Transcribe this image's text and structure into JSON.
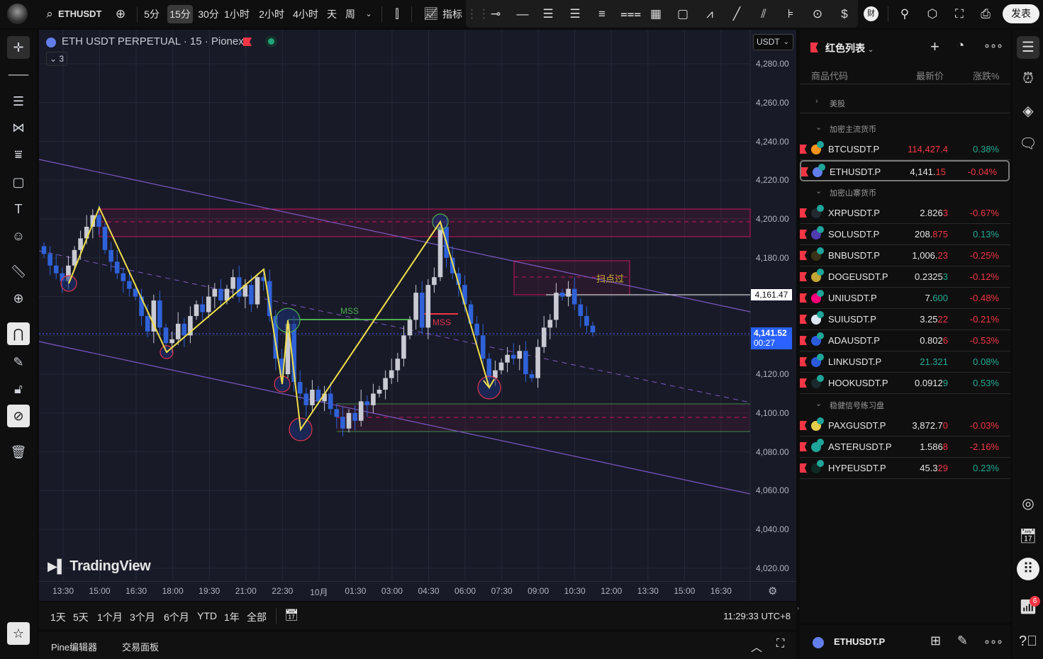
{
  "topbar": {
    "symbol": "ETHUSDT",
    "intervals": [
      "5分",
      "15分",
      "30分",
      "1小时",
      "2小时",
      "4小时",
      "天",
      "周"
    ],
    "selected_interval": "15分",
    "indicators_label": "指标",
    "publish_label": "发表",
    "finance_badge": "财"
  },
  "chart": {
    "title": "ETH USDT PERPETUAL · 15 · Pionex",
    "collapse_count": "3",
    "currency": "USDT",
    "price_ticks": [
      "4,280.00",
      "4,260.00",
      "4,240.00",
      "4,220.00",
      "4,200.00",
      "4,180.00",
      "4,160.00",
      "4,140.00",
      "4,120.00",
      "4,100.00",
      "4,080.00",
      "4,060.00",
      "4,040.00",
      "4,020.00"
    ],
    "time_ticks": [
      "13:30",
      "15:00",
      "16:30",
      "18:00",
      "19:30",
      "21:00",
      "22:30",
      "10月",
      "01:30",
      "03:00",
      "04:30",
      "06:00",
      "07:30",
      "09:00",
      "10:30",
      "12:00",
      "13:30",
      "15:00",
      "16:30"
    ],
    "line_label_price": "4,161.47",
    "last_price": "4,141.52",
    "countdown": "00:27",
    "mss_green": "MSS",
    "mss_red": "MSS",
    "box_label": "扫点过",
    "logo_text": "TradingView",
    "colors": {
      "up": "#c9cad3",
      "down": "#2f62d8",
      "zone": "#c2185b",
      "channel": "#7e57c2",
      "zigzag": "#f0e04a",
      "mss_green": "#4caf50",
      "mss_red": "#f23645"
    },
    "closes": [
      4182,
      4176,
      4172,
      4168,
      4176,
      4184,
      4190,
      4196,
      4202,
      4196,
      4184,
      4178,
      4172,
      4168,
      4164,
      4160,
      4150,
      4142,
      4158,
      4144,
      4136,
      4138,
      4146,
      4140,
      4150,
      4156,
      4152,
      4160,
      4164,
      4158,
      4164,
      4170,
      4160,
      4166,
      4156,
      4170,
      4168,
      4150,
      4128,
      4120,
      4146,
      4116,
      4110,
      4104,
      4112,
      4106,
      4110,
      4102,
      4098,
      4092,
      4100,
      4096,
      4106,
      4104,
      4110,
      4112,
      4118,
      4122,
      4128,
      4140,
      4148,
      4162,
      4144,
      4166,
      4170,
      4196,
      4180,
      4172,
      4166,
      4156,
      4146,
      4140,
      4128,
      4118,
      4122,
      4126,
      4130,
      4128,
      4132,
      4120,
      4118,
      4134,
      4144,
      4148,
      4162,
      4160,
      4164,
      4156,
      4150,
      4145,
      4141.52
    ]
  },
  "range": {
    "buttons": [
      "1天",
      "5天",
      "1个月",
      "3个月",
      "6个月",
      "YTD",
      "1年",
      "全部"
    ],
    "clock": "11:29:33 UTC+8"
  },
  "bottom": {
    "pine_editor": "Pine编辑器",
    "trading_panel": "交易面板"
  },
  "watchlist": {
    "title": "红色列表",
    "col_symbol": "商品代码",
    "col_price": "最新价",
    "col_change": "涨跌%",
    "items": [
      {
        "group": "美股",
        "collapsed": true
      },
      {
        "group": "加密主流货币"
      },
      {
        "sym": "BTCUSDT.P",
        "pm": "",
        "pt": "114,427.4",
        "tc": "#f23645",
        "chg": "0.38%",
        "cc": "#22ab94",
        "coin": "#f7931a"
      },
      {
        "sym": "ETHUSDT.P",
        "pm": "4,141.",
        "pt": "15",
        "tc": "#f23645",
        "chg": "-0.04%",
        "cc": "#f23645",
        "coin": "#627eea",
        "selected": true
      },
      {
        "group": "加密山寨货币"
      },
      {
        "sym": "XRPUSDT.P",
        "pm": "2.826",
        "pt": "3",
        "tc": "#f23645",
        "chg": "-0.67%",
        "cc": "#f23645",
        "coin": "#23292f"
      },
      {
        "sym": "SOLUSDT.P",
        "pm": "208.",
        "pt": "875",
        "tc": "#f23645",
        "chg": "0.13%",
        "cc": "#22ab94",
        "coin": "#4e3bb0"
      },
      {
        "sym": "BNBUSDT.P",
        "pm": "1,006.",
        "pt": "23",
        "tc": "#f23645",
        "chg": "-0.25%",
        "cc": "#f23645",
        "coin": "#3a3216"
      },
      {
        "sym": "DOGEUSDT.P",
        "pm": "0.2325",
        "pt": "3",
        "tc": "#22ab94",
        "chg": "-0.12%",
        "cc": "#f23645",
        "coin": "#c2a633"
      },
      {
        "sym": "UNIUSDT.P",
        "pm": "7.",
        "pt": "600",
        "tc": "#22ab94",
        "chg": "-0.48%",
        "cc": "#f23645",
        "coin": "#ff007a"
      },
      {
        "sym": "SUIUSDT.P",
        "pm": "3.25",
        "pt": "22",
        "tc": "#f23645",
        "chg": "-0.21%",
        "cc": "#f23645",
        "coin": "#dce8f5"
      },
      {
        "sym": "ADAUSDT.P",
        "pm": "0.802",
        "pt": "6",
        "tc": "#f23645",
        "chg": "-0.53%",
        "cc": "#f23645",
        "coin": "#2a5ada"
      },
      {
        "sym": "LINKUSDT.P",
        "pm": "",
        "pt": "21.321",
        "tc": "#22ab94",
        "chg": "0.08%",
        "cc": "#22ab94",
        "coin": "#2a5ada"
      },
      {
        "sym": "HOOKUSDT.P",
        "pm": "0.0912",
        "pt": "9",
        "tc": "#22ab94",
        "chg": "0.53%",
        "cc": "#22ab94",
        "coin": "#1a2a2a"
      },
      {
        "group": "稳健信号练习盘"
      },
      {
        "sym": "PAXGUSDT.P",
        "pm": "3,872.7",
        "pt": "0",
        "tc": "#f23645",
        "chg": "-0.03%",
        "cc": "#f23645",
        "coin": "#e4ce4b"
      },
      {
        "sym": "ASTERUSDT.P",
        "pm": "1.586",
        "pt": "8",
        "tc": "#f23645",
        "chg": "-2.16%",
        "cc": "#f23645",
        "coin": "#1fa59a"
      },
      {
        "sym": "HYPEUSDT.P",
        "pm": "45.3",
        "pt": "29",
        "tc": "#f23645",
        "chg": "0.23%",
        "cc": "#22ab94",
        "coin": "#0f2a25"
      }
    ],
    "footer_symbol": "ETHUSDT.P"
  },
  "notifications": {
    "badge": "6"
  }
}
